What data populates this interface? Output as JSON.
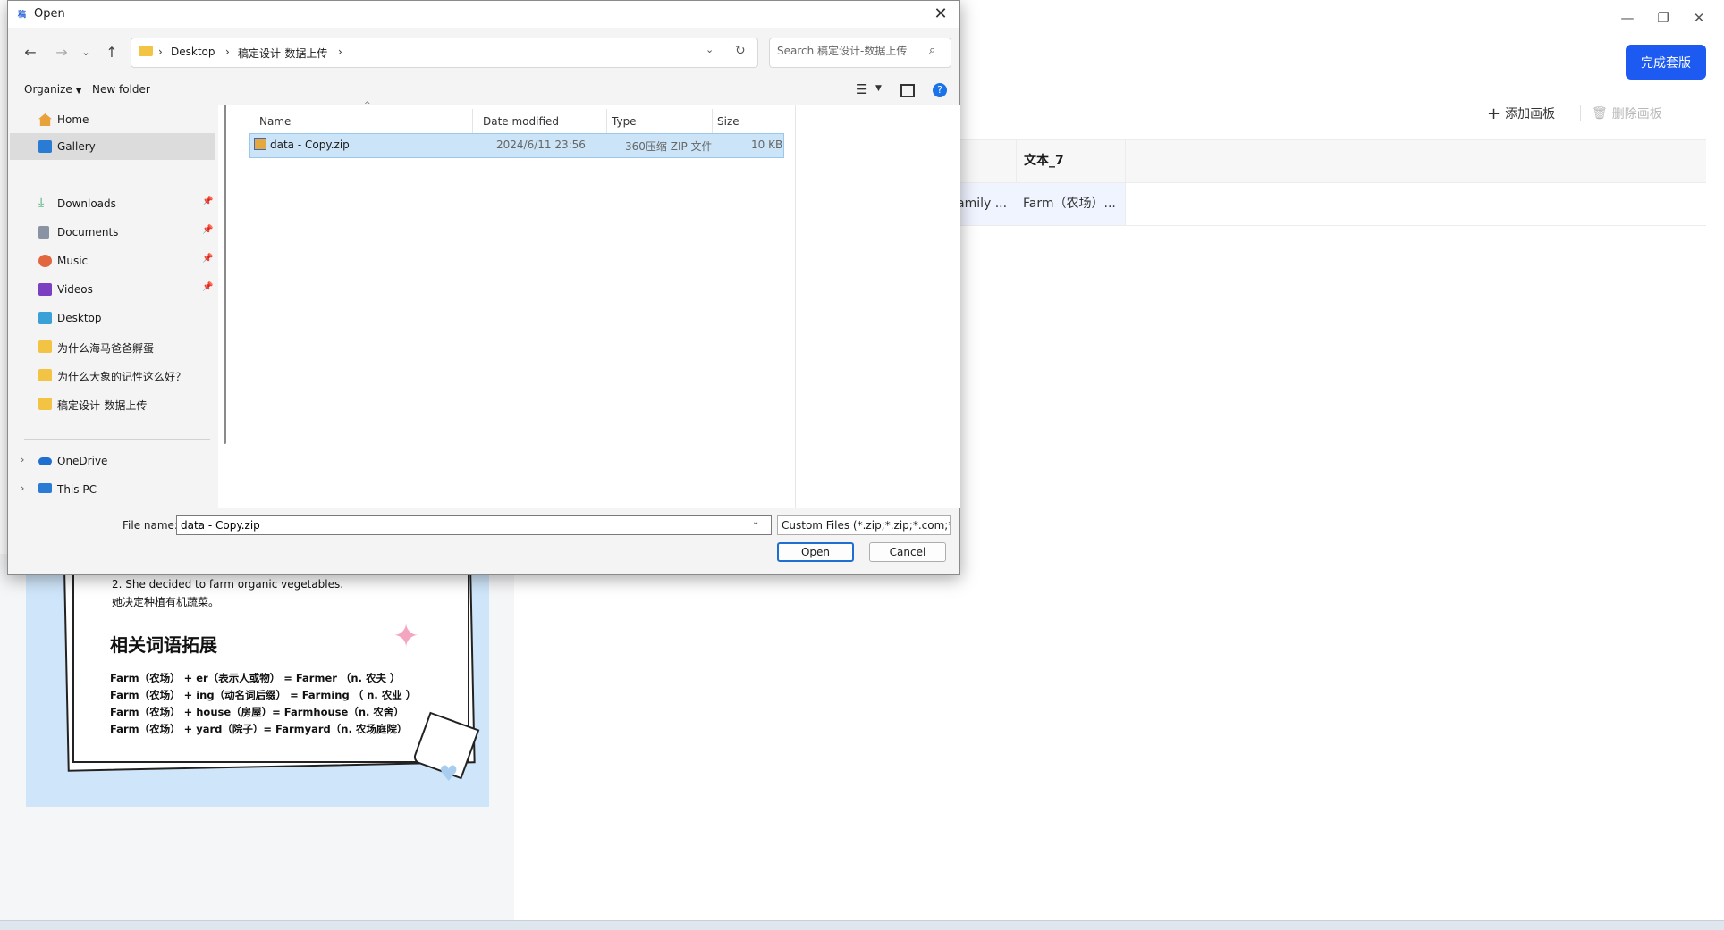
{
  "app": {
    "finish_button": "完成套版",
    "add_board": "添加画板",
    "delete_board": "删除画板",
    "table": {
      "header_col2": "文本_7",
      "row1_col1": "amily ...",
      "row1_col2": "Farm（农场）..."
    },
    "slide": {
      "line1": "2. She decided to farm organic vegetables.",
      "line2": "她决定种植有机蔬菜。",
      "heading": "相关词语拓展",
      "rows": [
        "Farm（农场） + er（表示人或物） = Farmer （n. 农夫 ）",
        "Farm（农场） + ing（动名词后缀） = Farming （ n. 农业 ）",
        "Farm（农场） + house（房屋）= Farmhouse（n. 农舍）",
        "Farm（农场） + yard（院子）= Farmyard（n. 农场庭院）"
      ]
    }
  },
  "dialog": {
    "title": "Open",
    "breadcrumbs": [
      "Desktop",
      "稿定设计-数据上传"
    ],
    "search_placeholder": "Search 稿定设计-数据上传",
    "organize": "Organize",
    "new_folder": "New folder",
    "nav_items": [
      {
        "label": "Home"
      },
      {
        "label": "Gallery"
      },
      {
        "label": "Downloads"
      },
      {
        "label": "Documents"
      },
      {
        "label": "Music"
      },
      {
        "label": "Videos"
      },
      {
        "label": "Desktop"
      },
      {
        "label": "为什么海马爸爸孵蛋"
      },
      {
        "label": "为什么大象的记性这么好？"
      },
      {
        "label": "稿定设计-数据上传"
      },
      {
        "label": "OneDrive"
      },
      {
        "label": "This PC"
      }
    ],
    "columns": {
      "name": "Name",
      "date": "Date modified",
      "type": "Type",
      "size": "Size"
    },
    "file": {
      "name": "data - Copy.zip",
      "date": "2024/6/11 23:56",
      "type": "360压缩 ZIP 文件",
      "size": "10 KB"
    },
    "filename_label": "File name:",
    "filename_value": "data - Copy.zip",
    "filetype": "Custom Files (*.zip;*.zip;*.com;*",
    "open_button": "Open",
    "cancel_button": "Cancel"
  },
  "colors": {
    "accent": "#1d5af1",
    "selection": "#cce4f7",
    "slide_bg": "#cfe6fa"
  }
}
